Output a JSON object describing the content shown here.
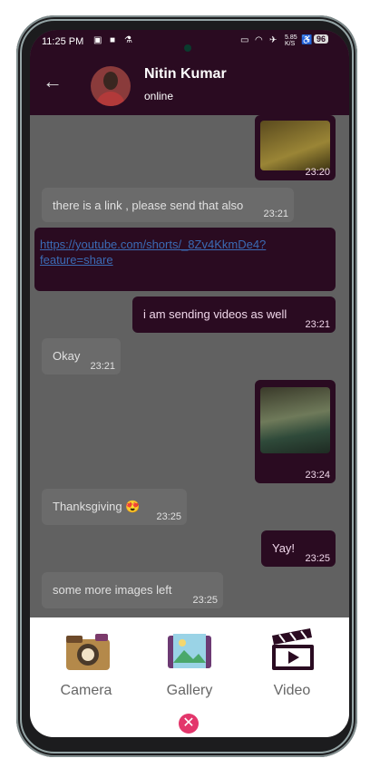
{
  "status": {
    "time": "11:25 PM",
    "battery": "96",
    "speed": "5.85 K/S"
  },
  "header": {
    "name": "Nitin Kumar",
    "presence": "online"
  },
  "messages": [
    {
      "side": "out",
      "type": "image",
      "time": "23:20"
    },
    {
      "side": "in",
      "type": "text",
      "text": "there is a link , please send that also",
      "time": "23:21"
    },
    {
      "side": "out",
      "type": "link",
      "text": "https://youtube.com/shorts/_8Zv4KkmDe4?feature=share"
    },
    {
      "side": "out",
      "type": "text",
      "text": "i am sending videos as well",
      "time": "23:21"
    },
    {
      "side": "in",
      "type": "text",
      "text": "Okay",
      "time": "23:21"
    },
    {
      "side": "out",
      "type": "image",
      "time": "23:24"
    },
    {
      "side": "in",
      "type": "text",
      "text": "Thanksgiving 😍",
      "time": "23:25"
    },
    {
      "side": "out",
      "type": "text",
      "text": "Yay!",
      "time": "23:25"
    },
    {
      "side": "in",
      "type": "text",
      "text": "some more images left",
      "time": "23:25"
    }
  ],
  "attach_sheet": {
    "options": [
      {
        "label": "Camera",
        "icon": "camera-icon"
      },
      {
        "label": "Gallery",
        "icon": "gallery-icon"
      },
      {
        "label": "Video",
        "icon": "clapperboard-icon"
      }
    ],
    "close_icon": "close-icon"
  },
  "colors": {
    "header": "#2a0b21",
    "outgoing": "#2a0b21",
    "incoming": "#6b6b6b",
    "close": "#e3366b"
  }
}
